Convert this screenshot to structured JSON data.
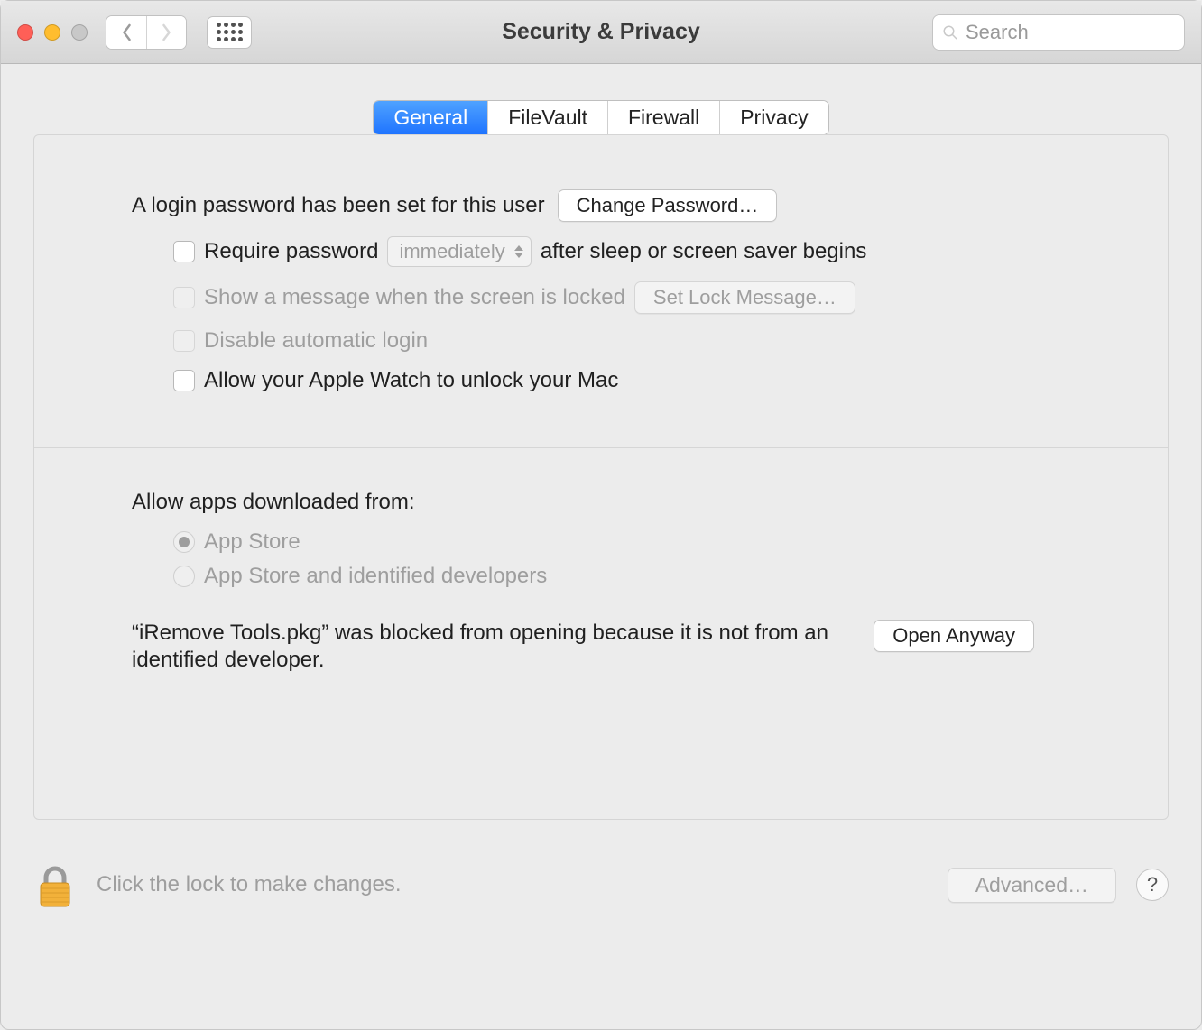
{
  "window": {
    "title": "Security & Privacy"
  },
  "toolbar": {
    "search_placeholder": "Search"
  },
  "tabs": {
    "general": "General",
    "filevault": "FileVault",
    "firewall": "Firewall",
    "privacy": "Privacy"
  },
  "general": {
    "login_password_text": "A login password has been set for this user",
    "change_password_label": "Change Password…",
    "require_password_label": "Require password",
    "require_password_delay": "immediately",
    "require_password_suffix": "after sleep or screen saver begins",
    "show_message_label": "Show a message when the screen is locked",
    "set_lock_message_label": "Set Lock Message…",
    "disable_auto_login_label": "Disable automatic login",
    "apple_watch_label": "Allow your Apple Watch to unlock your Mac",
    "allow_apps_heading": "Allow apps downloaded from:",
    "radio_app_store": "App Store",
    "radio_app_store_dev": "App Store and identified developers",
    "blocked_message": "“iRemove Tools.pkg” was blocked from opening because it is not from an identified developer.",
    "open_anyway_label": "Open Anyway"
  },
  "footer": {
    "lock_text": "Click the lock to make changes.",
    "advanced_label": "Advanced…",
    "help_label": "?"
  }
}
